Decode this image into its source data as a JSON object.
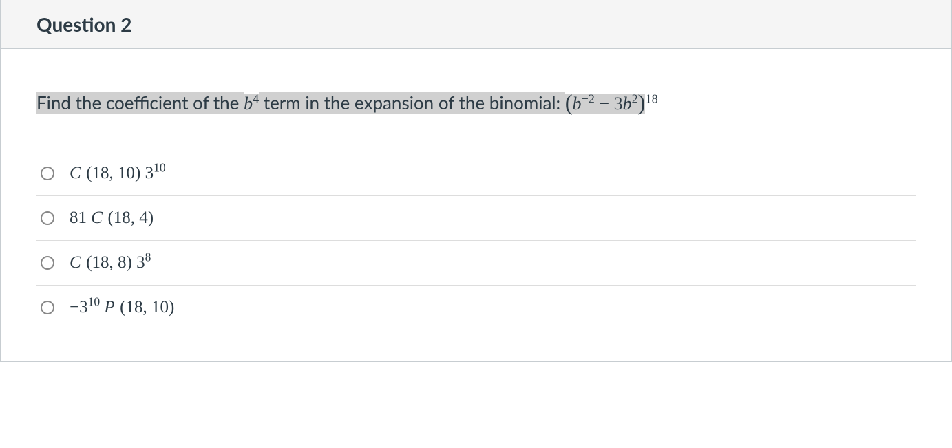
{
  "header": {
    "title": "Question 2"
  },
  "prompt": {
    "part1": "Find the coefficient of the ",
    "target_base": "b",
    "target_exp": "4",
    "part2": " term in the expansion of the binomial: ",
    "binom_a_base": "b",
    "binom_a_exp": "−2",
    "binom_op": " − ",
    "binom_b_coef": "3",
    "binom_b_base": "b",
    "binom_b_exp": "2",
    "outer_exp": "18"
  },
  "answers": [
    {
      "id": "a",
      "prefix": "",
      "fn": "C",
      "args": "(18, 10)",
      "tail_coef": " 3",
      "tail_exp": "10"
    },
    {
      "id": "b",
      "prefix": "81 ",
      "fn": "C",
      "args": "(18, 4)",
      "tail_coef": "",
      "tail_exp": ""
    },
    {
      "id": "c",
      "prefix": "",
      "fn": "C",
      "args": "(18, 8)",
      "tail_coef": " 3",
      "tail_exp": "8"
    },
    {
      "id": "d",
      "prefix": "−3",
      "prefix_exp": "10",
      "prefix2": " ",
      "fn": "P",
      "args": "(18, 10)",
      "tail_coef": "",
      "tail_exp": ""
    }
  ]
}
